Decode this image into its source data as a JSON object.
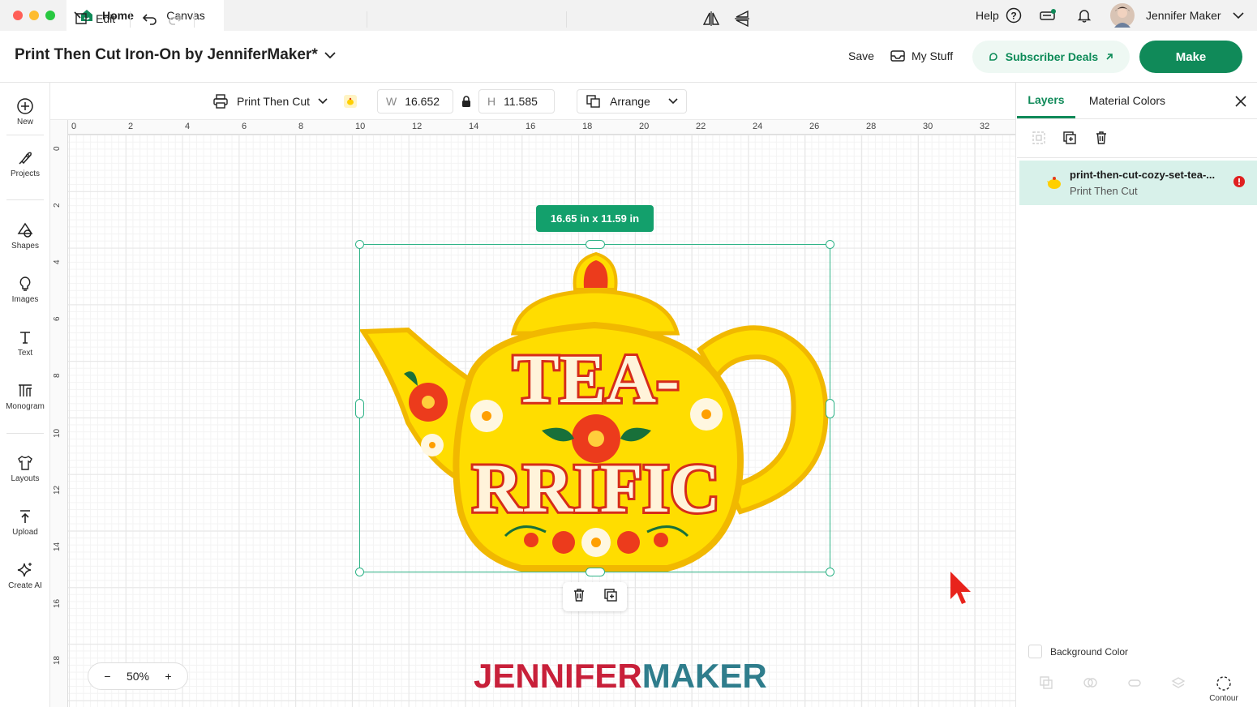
{
  "window": {
    "tabs": [
      {
        "label": "Home"
      },
      {
        "label": "Canvas"
      }
    ]
  },
  "topbar": {
    "help_label": "Help",
    "user_name": "Jennifer Maker"
  },
  "header": {
    "project_title": "Print Then Cut Iron-On by JenniferMaker*",
    "save_label": "Save",
    "mystuff_label": "My Stuff",
    "deals_label": "Subscriber Deals",
    "make_label": "Make"
  },
  "sidebar": {
    "items": [
      {
        "label": "New"
      },
      {
        "label": "Projects"
      },
      {
        "label": "Shapes"
      },
      {
        "label": "Images"
      },
      {
        "label": "Text"
      },
      {
        "label": "Monogram"
      },
      {
        "label": "Layouts"
      },
      {
        "label": "Upload"
      },
      {
        "label": "Create AI"
      }
    ]
  },
  "toolbar": {
    "edit_label": "Edit",
    "operation_label": "Print Then Cut",
    "width_prefix": "W",
    "width_value": "16.652",
    "height_prefix": "H",
    "height_value": "11.585",
    "arrange_label": "Arrange"
  },
  "ruler": {
    "top_labels": [
      "0",
      "2",
      "4",
      "6",
      "8",
      "10",
      "12",
      "14",
      "16",
      "18",
      "20",
      "22",
      "24",
      "26",
      "28",
      "30",
      "32"
    ],
    "left_labels": [
      "0",
      "2",
      "4",
      "6",
      "8",
      "10",
      "12",
      "14",
      "16",
      "18"
    ]
  },
  "canvas": {
    "dimension_badge": "16.65  in x 11.59  in",
    "art_text_line1": "TEA-",
    "art_text_line2": "RRIFIC",
    "zoom_minus": "−",
    "zoom_value": "50%",
    "zoom_plus": "+",
    "watermark_part1": "JENNIFER",
    "watermark_part2": "MAKER"
  },
  "panel": {
    "tab_layers": "Layers",
    "tab_colors": "Material Colors",
    "layer_name": "print-then-cut-cozy-set-tea-...",
    "layer_type": "Print Then Cut",
    "background_color_label": "Background Color",
    "contour_label": "Contour"
  },
  "colors": {
    "brand_green": "#108a59",
    "accent_green": "#2fb387",
    "watermark_red": "#c8203a",
    "watermark_teal": "#2f7d8c",
    "teapot_yellow": "#ffdf00"
  }
}
